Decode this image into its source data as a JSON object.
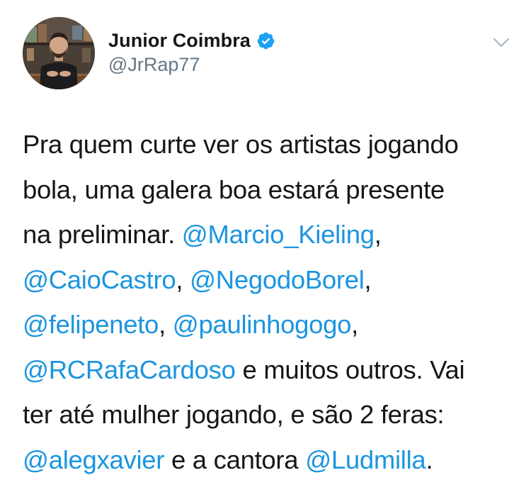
{
  "user": {
    "display_name": "Junior Coimbra",
    "handle": "@JrRap77",
    "verified": true
  },
  "icons": {
    "avatar": "profile-photo",
    "verified": "verified-badge-icon",
    "menu": "chevron-down-icon"
  },
  "colors": {
    "mention": "#1b95e0",
    "text": "#14171a",
    "handle": "#657786",
    "verified": "#1da1f2"
  },
  "tweet": {
    "lines": [
      [
        {
          "text": "Pra quem curte ver os artistas jogando",
          "mention": false
        }
      ],
      [
        {
          "text": "bola, uma galera boa estará presente",
          "mention": false
        }
      ],
      [
        {
          "text": "na preliminar. ",
          "mention": false
        },
        {
          "text": "@Marcio_Kieling",
          "mention": true
        },
        {
          "text": ",",
          "mention": false
        }
      ],
      [
        {
          "text": "@CaioCastro",
          "mention": true
        },
        {
          "text": ", ",
          "mention": false
        },
        {
          "text": "@NegodoBorel",
          "mention": true
        },
        {
          "text": ",",
          "mention": false
        }
      ],
      [
        {
          "text": "@felipeneto",
          "mention": true
        },
        {
          "text": ", ",
          "mention": false
        },
        {
          "text": "@paulinhogogo",
          "mention": true
        },
        {
          "text": ",",
          "mention": false
        }
      ],
      [
        {
          "text": "@RCRafaCardoso",
          "mention": true
        },
        {
          "text": " e muitos outros. Vai",
          "mention": false
        }
      ],
      [
        {
          "text": "ter até mulher jogando, e são 2 feras:",
          "mention": false
        }
      ],
      [
        {
          "text": "@alegxavier",
          "mention": true
        },
        {
          "text": " e a cantora ",
          "mention": false
        },
        {
          "text": "@Ludmilla",
          "mention": true
        },
        {
          "text": ".",
          "mention": false
        }
      ]
    ]
  }
}
